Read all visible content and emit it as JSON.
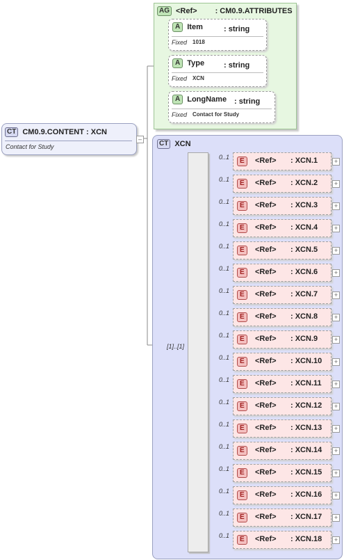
{
  "root": {
    "badge": "CT",
    "title": "CM0.9.CONTENT : XCN",
    "doc": "Contact for Study"
  },
  "attribute_group": {
    "badge": "AG",
    "ref": "<Ref>",
    "name": ": CM0.9.ATTRIBUTES",
    "attributes": [
      {
        "badge": "A",
        "name": "Item",
        "type": ": string",
        "fixed_label": "Fixed",
        "fixed_value": "1018"
      },
      {
        "badge": "A",
        "name": "Type",
        "type": ": string",
        "fixed_label": "Fixed",
        "fixed_value": "XCN"
      },
      {
        "badge": "A",
        "name": "LongName",
        "type": ": string",
        "fixed_label": "Fixed",
        "fixed_value": "Contact for Study"
      }
    ]
  },
  "complex_type": {
    "badge": "CT",
    "name": "XCN",
    "sequence_occurs": "[1]..[1]"
  },
  "elements": [
    {
      "occurs": "0..1",
      "badge": "E",
      "ref": "<Ref>",
      "type": ": XCN.1",
      "expander": "+"
    },
    {
      "occurs": "0..1",
      "badge": "E",
      "ref": "<Ref>",
      "type": ": XCN.2",
      "expander": "+"
    },
    {
      "occurs": "0..1",
      "badge": "E",
      "ref": "<Ref>",
      "type": ": XCN.3",
      "expander": "+"
    },
    {
      "occurs": "0..1",
      "badge": "E",
      "ref": "<Ref>",
      "type": ": XCN.4",
      "expander": "+"
    },
    {
      "occurs": "0..1",
      "badge": "E",
      "ref": "<Ref>",
      "type": ": XCN.5",
      "expander": "+"
    },
    {
      "occurs": "0..1",
      "badge": "E",
      "ref": "<Ref>",
      "type": ": XCN.6",
      "expander": "+"
    },
    {
      "occurs": "0..1",
      "badge": "E",
      "ref": "<Ref>",
      "type": ": XCN.7",
      "expander": "+"
    },
    {
      "occurs": "0..1",
      "badge": "E",
      "ref": "<Ref>",
      "type": ": XCN.8",
      "expander": "+"
    },
    {
      "occurs": "0..1",
      "badge": "E",
      "ref": "<Ref>",
      "type": ": XCN.9",
      "expander": "+"
    },
    {
      "occurs": "0..1",
      "badge": "E",
      "ref": "<Ref>",
      "type": ": XCN.10",
      "expander": "+"
    },
    {
      "occurs": "0..1",
      "badge": "E",
      "ref": "<Ref>",
      "type": ": XCN.11",
      "expander": "+"
    },
    {
      "occurs": "0..1",
      "badge": "E",
      "ref": "<Ref>",
      "type": ": XCN.12",
      "expander": "+"
    },
    {
      "occurs": "0..1",
      "badge": "E",
      "ref": "<Ref>",
      "type": ": XCN.13",
      "expander": "+"
    },
    {
      "occurs": "0..1",
      "badge": "E",
      "ref": "<Ref>",
      "type": ": XCN.14",
      "expander": "+"
    },
    {
      "occurs": "0..1",
      "badge": "E",
      "ref": "<Ref>",
      "type": ": XCN.15",
      "expander": "+"
    },
    {
      "occurs": "0..1",
      "badge": "E",
      "ref": "<Ref>",
      "type": ": XCN.16",
      "expander": "+"
    },
    {
      "occurs": "0..1",
      "badge": "E",
      "ref": "<Ref>",
      "type": ": XCN.17",
      "expander": "+"
    },
    {
      "occurs": "0..1",
      "badge": "E",
      "ref": "<Ref>",
      "type": ": XCN.18",
      "expander": "+"
    }
  ],
  "collapse_symbol": "–",
  "colors": {
    "element_fill": "#fde6e6",
    "attribute_group_fill": "#e7f7e1",
    "complex_type_fill": "#dcdff9"
  }
}
